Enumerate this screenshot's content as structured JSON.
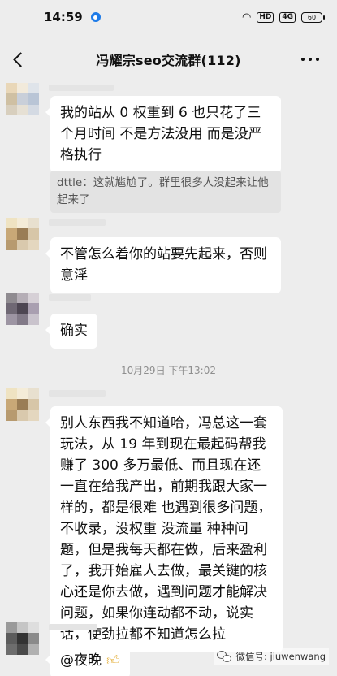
{
  "status_bar": {
    "time": "14:59",
    "indicators": [
      "wifi-icon",
      "hd-badge",
      "signal-4g-icon"
    ],
    "hd_label": "HD",
    "network_label": "4G",
    "battery": "60"
  },
  "header": {
    "title": "冯耀宗seo交流群(112)"
  },
  "messages": [
    {
      "type": "text",
      "text": "我的站从 0 权重到 6 也只花了三个月时间 不是方法没用 而是没严格执行",
      "quote": "dttle：这就尴尬了。群里很多人没起来让他起来了"
    },
    {
      "type": "text",
      "text": "不管怎么着你的站要先起来，否则意淫"
    },
    {
      "type": "text",
      "text": "确实"
    },
    {
      "type": "time",
      "text": "10月29日 下午13:02"
    },
    {
      "type": "text",
      "text": "别人东西我不知道哈，冯总这一套玩法，从 19 年到现在最起码帮我赚了 300 多万最低、而且现在还一直在给我产出，前期我跟大家一样的，都是很难 也遇到很多问题，不收录，没权重 没流量 种种问题，但是我每天都在做，后来盈利了，我开始雇人去做，最关键的核心还是你去做，遇到问题才能解决问题，如果你连动都不动，说实话，使劲拉都不知道怎么拉"
    },
    {
      "type": "text",
      "text": "@夜晚",
      "icon": "thumbs-up-icon"
    }
  ],
  "watermark": {
    "text": "微信号: jiuwenwang"
  },
  "colors": {
    "background": "#ededed",
    "bubble": "#ffffff",
    "quote": "#e3e3e3",
    "accent": "#1e7be8"
  }
}
